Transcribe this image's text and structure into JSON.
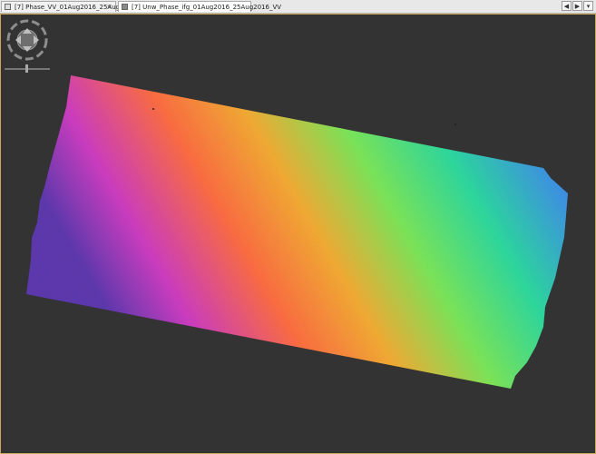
{
  "tabs": [
    {
      "label": "[7] Phase_VV_01Aug2016_25Aug2016",
      "active": false,
      "close": "×"
    },
    {
      "label": "[7] Unw_Phase_ifg_01Aug2016_25Aug2016_VV",
      "active": true,
      "close": ""
    }
  ],
  "tab_nav": {
    "prev": "◀",
    "next": "▶",
    "menu": "▾"
  },
  "viewport": {
    "background_color": "#333333",
    "frame_color": "#c9a85a"
  },
  "navigation_control": {
    "icons": [
      "pan-up-icon",
      "pan-down-icon",
      "pan-left-icon",
      "pan-right-icon",
      "rotation-slider"
    ]
  },
  "image": {
    "type": "unwrapped-phase-raster",
    "colors": [
      "#6a3ab0",
      "#d63fbf",
      "#ff7a3c",
      "#f6b334",
      "#6ee85c",
      "#28d6a5",
      "#3e90e6",
      "#5e4ad0"
    ]
  }
}
